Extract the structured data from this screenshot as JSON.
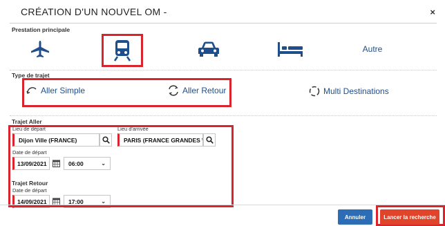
{
  "dialog": {
    "title": "CRÉATION D'UN NOUVEL OM -",
    "close": "×"
  },
  "prestation": {
    "label": "Prestation principale",
    "modes": [
      {
        "name": "avion",
        "icon": "plane-icon"
      },
      {
        "name": "train",
        "icon": "train-icon",
        "selected": true
      },
      {
        "name": "voiture",
        "icon": "car-icon"
      },
      {
        "name": "hotel",
        "icon": "bed-icon"
      },
      {
        "name": "autre",
        "label": "Autre"
      }
    ]
  },
  "type_trajet": {
    "label": "Type de trajet",
    "options": [
      {
        "label": "Aller Simple",
        "icon": "one-way-arc-icon"
      },
      {
        "label": "Aller Retour",
        "icon": "round-trip-circle-icon"
      },
      {
        "label": "Multi Destinations",
        "icon": "multi-destination-circle-icon"
      }
    ]
  },
  "trajet_aller": {
    "label": "Trajet Aller",
    "depart_label": "Lieu de départ",
    "depart_value": "Dijon Ville (FRANCE)",
    "arrivee_label": "Lieu d'arrivée",
    "arrivee_value": "PARIS (FRANCE GRANDES \\",
    "date_label": "Date de départ",
    "date_value": "13/09/2021",
    "time_value": "06:00"
  },
  "trajet_retour": {
    "label": "Trajet Retour",
    "date_label": "Date de départ",
    "date_value": "14/09/2021",
    "time_value": "17:00"
  },
  "footer": {
    "cancel_label": "Annuler",
    "search_label": "Lancer la recherche"
  },
  "colors": {
    "accent_blue": "#1f4e8c",
    "highlight_red": "#d9232d",
    "cancel_blue": "#2d6db5",
    "search_orange": "#e0452b"
  }
}
